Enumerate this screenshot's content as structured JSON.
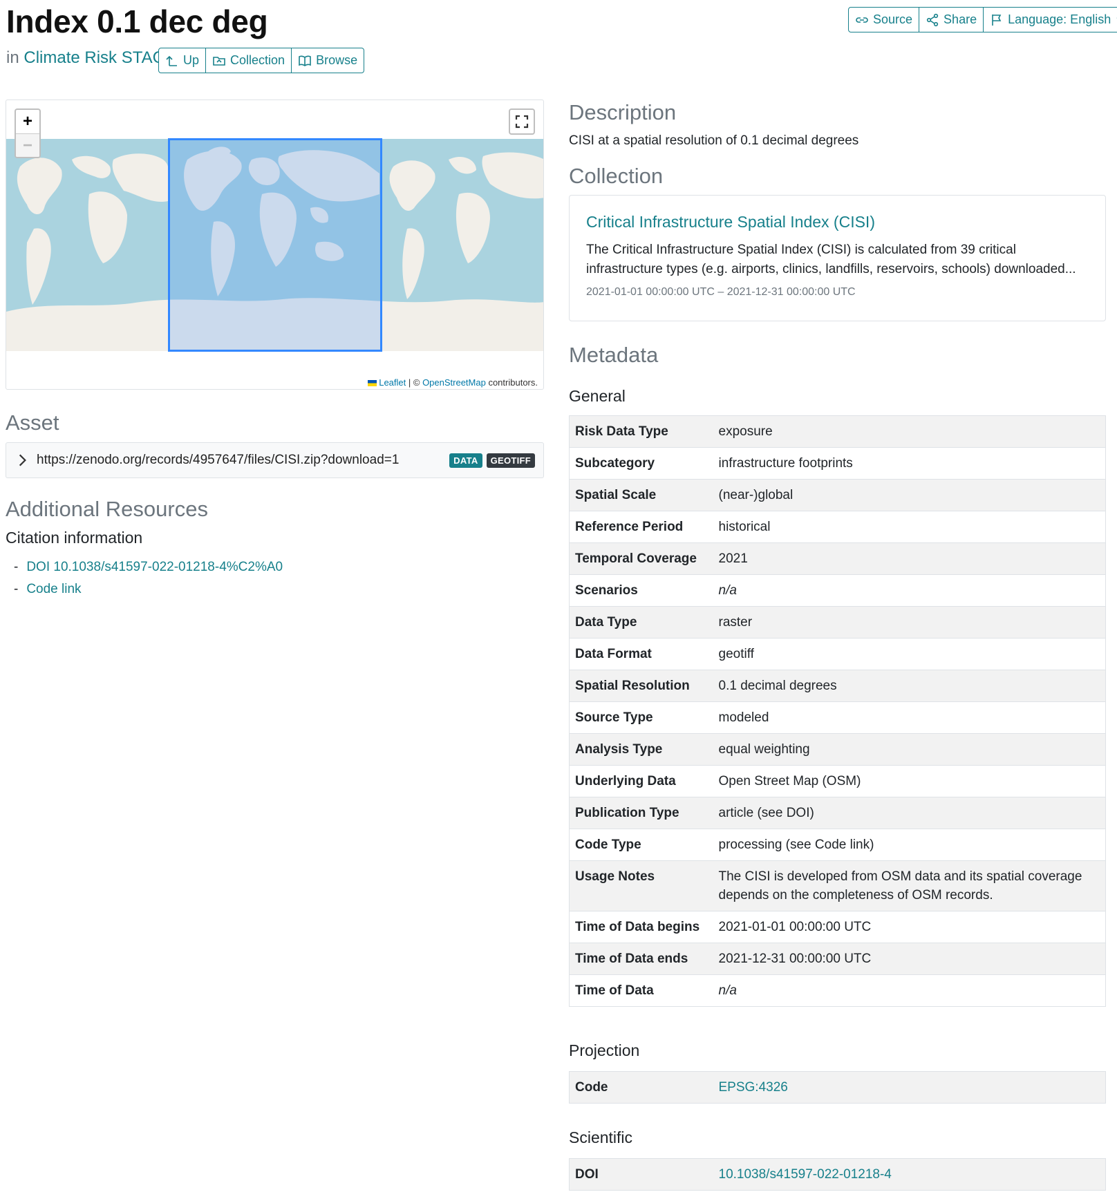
{
  "header": {
    "title": "Index 0.1 dec deg",
    "in_prefix": "in",
    "catalog_link": "Climate Risk STAC",
    "nav": {
      "up": "Up",
      "collection": "Collection",
      "browse": "Browse"
    },
    "tools": {
      "source": "Source",
      "share": "Share",
      "language": "Language: English"
    }
  },
  "map": {
    "zoom_in": "+",
    "zoom_out": "−",
    "attribution": {
      "leaflet": "Leaflet",
      "sep": " | © ",
      "osm": "OpenStreetMap",
      "suffix": " contributors."
    }
  },
  "asset": {
    "heading": "Asset",
    "url": "https://zenodo.org/records/4957647/files/CISI.zip?download=1",
    "badges": [
      "DATA",
      "GEOTIFF"
    ]
  },
  "additional": {
    "heading": "Additional Resources",
    "citation_heading": "Citation information",
    "links": [
      "DOI 10.1038/s41597-022-01218-4%C2%A0",
      "Code link"
    ]
  },
  "description": {
    "heading": "Description",
    "text": "CISI at a spatial resolution of 0.1 decimal degrees"
  },
  "collection": {
    "heading": "Collection",
    "title": "Critical Infrastructure Spatial Index (CISI)",
    "text": "The Critical Infrastructure Spatial Index (CISI) is calculated from 39 critical infrastructure types (e.g. airports, clinics, landfills, reservoirs, schools) downloaded...",
    "time": "2021-01-01 00:00:00 UTC – 2021-12-31 00:00:00 UTC"
  },
  "metadata": {
    "heading": "Metadata",
    "general_heading": "General",
    "general": [
      {
        "k": "Risk Data Type",
        "v": "exposure"
      },
      {
        "k": "Subcategory",
        "v": "infrastructure footprints"
      },
      {
        "k": "Spatial Scale",
        "v": "(near-)global"
      },
      {
        "k": "Reference Period",
        "v": "historical"
      },
      {
        "k": "Temporal Coverage",
        "v": "2021"
      },
      {
        "k": "Scenarios",
        "v": "n/a"
      },
      {
        "k": "Data Type",
        "v": "raster"
      },
      {
        "k": "Data Format",
        "v": "geotiff"
      },
      {
        "k": "Spatial Resolution",
        "v": "0.1 decimal degrees"
      },
      {
        "k": "Source Type",
        "v": "modeled"
      },
      {
        "k": "Analysis Type",
        "v": "equal weighting"
      },
      {
        "k": "Underlying Data",
        "v": "Open Street Map (OSM)"
      },
      {
        "k": "Publication Type",
        "v": "article (see DOI)"
      },
      {
        "k": "Code Type",
        "v": "processing (see Code link)"
      },
      {
        "k": "Usage Notes",
        "v": "The CISI is developed from OSM data and its spatial coverage depends on the completeness of OSM records."
      },
      {
        "k": "Time of Data begins",
        "v": "2021-01-01 00:00:00 UTC"
      },
      {
        "k": "Time of Data ends",
        "v": "2021-12-31 00:00:00 UTC"
      },
      {
        "k": "Time of Data",
        "v": "n/a"
      }
    ],
    "projection_heading": "Projection",
    "projection": [
      {
        "k": "Code",
        "v": "EPSG:4326"
      }
    ],
    "scientific_heading": "Scientific",
    "scientific": [
      {
        "k": "DOI",
        "v": "10.1038/s41597-022-01218-4"
      }
    ]
  },
  "colors": {
    "accent": "#17808b",
    "ocean": "#aad3df",
    "land": "#f2efe9",
    "bbox": "#3388ff"
  }
}
